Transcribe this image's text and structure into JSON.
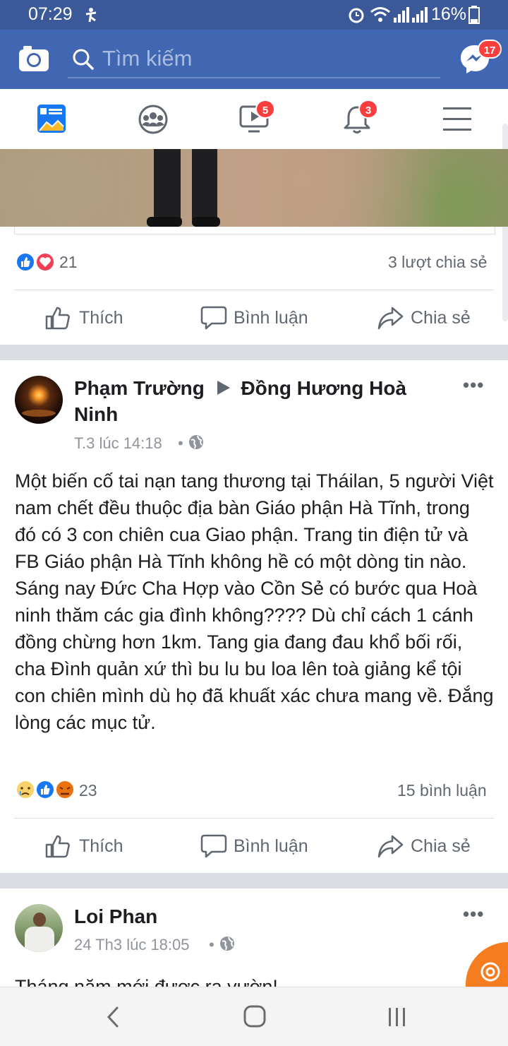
{
  "status_bar": {
    "time": "07:29",
    "battery": "16%"
  },
  "header": {
    "search_placeholder": "Tìm kiếm",
    "messenger_badge": "17"
  },
  "nav": {
    "watch_badge": "5",
    "notifications_badge": "3"
  },
  "post1": {
    "reaction_count": "21",
    "shares": "3 lượt chia sẻ"
  },
  "actions": {
    "like": "Thích",
    "comment": "Bình luận",
    "share": "Chia sẻ"
  },
  "post2": {
    "author": "Phạm Trường",
    "target": "Đồng Hương Hoà Ninh",
    "time": "T.3 lúc 14:18",
    "body": "Một biến cố tai nạn tang thương tại Tháilan, 5 người Việt nam chết đều thuộc địa bàn Giáo phận Hà Tĩnh, trong đó có 3 con chiên cua Giao phận. Trang tin điện tử và FB Giáo phận Hà Tĩnh không hề có một dòng tin nào. Sáng nay Đức Cha Hợp vào Cồn Sẻ có bước qua Hoà ninh thăm các gia đình không???? Dù chỉ cách 1 cánh đồng chừng hơn 1km. Tang gia đang đau khổ bối rối, cha Đình quản xứ thì bu lu bu loa lên toà giảng kể tội con chiên mình dù họ đã khuất xác chưa mang về. Đắng lòng các mục tử.",
    "reaction_count": "23",
    "comments": "15 bình luận"
  },
  "post3": {
    "author": "Loi Phan",
    "time": "24 Th3 lúc 18:05",
    "body_preview": "Tháng năm mới được ra vườn!"
  },
  "colors": {
    "header": "#4267b2",
    "status": "#3b5998",
    "badge": "#fa3e3e",
    "like": "#1877f2"
  }
}
